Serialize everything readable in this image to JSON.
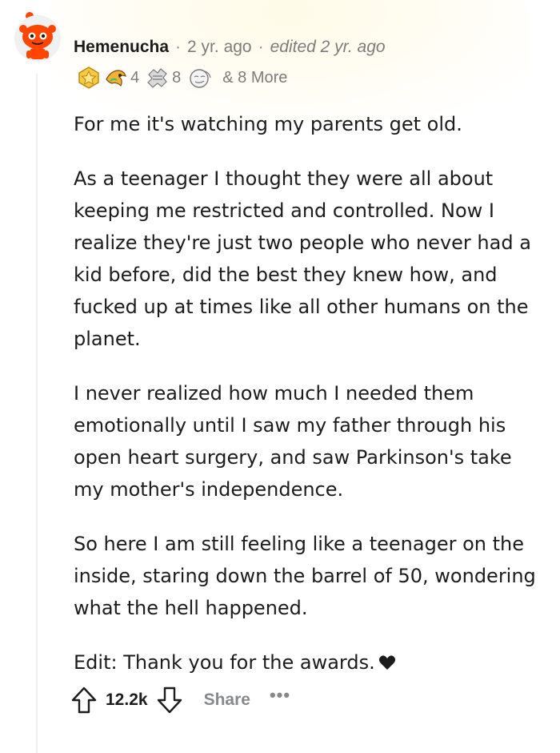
{
  "comment": {
    "author": "Hemenucha",
    "age": "2 yr. ago",
    "edited": "edited 2 yr. ago",
    "separator": "·",
    "awards": [
      {
        "icon": "gold-award-icon",
        "count": ""
      },
      {
        "icon": "wholesome-award-icon",
        "count": "4"
      },
      {
        "icon": "helpful-award-icon",
        "count": "8"
      },
      {
        "icon": "facepalm-award-icon",
        "count": ""
      }
    ],
    "awards_more": "& 8 More",
    "paragraphs": [
      "For me it's watching my parents get old.",
      "As a teenager I thought they were all about keeping me restricted and controlled. Now I realize they're just two people who never had a kid before, did the best they knew how, and fucked up at times like all other humans on the planet.",
      "I never realized how much I needed them emotionally until I saw my father through his open heart surgery, and saw Parkinson's take my mother's independence.",
      "So here I am still feeling like a teenager on the inside, staring down the barrel of 50, wondering what the hell happened.",
      "Edit: Thank you for the awards."
    ],
    "actions": {
      "vote_count": "12.2k",
      "share_label": "Share",
      "more_label": "•••"
    }
  },
  "colors": {
    "text": "#1c1c1c",
    "muted": "#7c7c7c",
    "avatar_red": "#ff4500",
    "thread_line": "#eceef0"
  }
}
